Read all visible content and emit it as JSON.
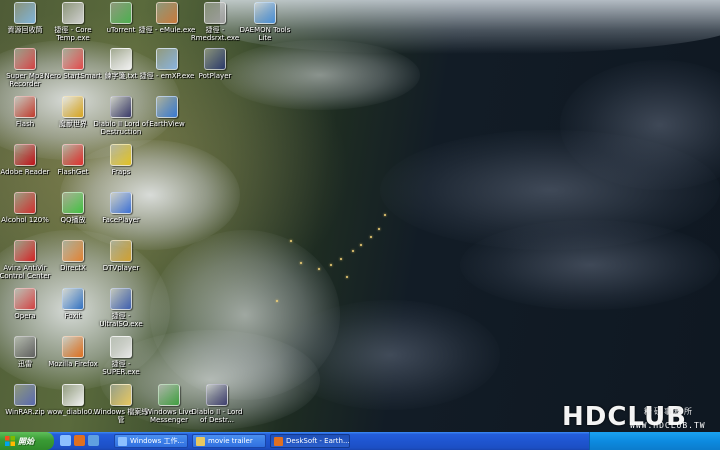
{
  "desktop": {
    "icons": [
      {
        "label": "資源回收筒",
        "icon": "recycle-bin-icon",
        "color": "#7fb3d9"
      },
      {
        "label": "捷徑 - Core Temp.exe",
        "icon": "shortcut-icon",
        "color": "#cfcfcf"
      },
      {
        "label": "uTorrent",
        "icon": "utorrent-icon",
        "color": "#4caf50"
      },
      {
        "label": "捷徑 - eMule.exe",
        "icon": "emule-icon",
        "color": "#c97a3c"
      },
      {
        "label": "捷徑 - Rmedsrxt.exe",
        "icon": "shortcut-icon",
        "color": "#a0a0a0"
      },
      {
        "label": "DAEMON Tools Lite",
        "icon": "daemon-tools-icon",
        "color": "#4a90d9"
      },
      {
        "label": "Super Mp3 Recorder",
        "icon": "mp3-recorder-icon",
        "color": "#d04040"
      },
      {
        "label": "Nero StartSmart",
        "icon": "nero-icon",
        "color": "#e04848"
      },
      {
        "label": "練字箋.txt",
        "icon": "text-file-icon",
        "color": "#f0f0f0"
      },
      {
        "label": "捷徑 - emXP.exe",
        "icon": "shortcut-icon",
        "color": "#8ab4e0"
      },
      {
        "label": "PotPlayer",
        "icon": "potplayer-icon",
        "color": "#2b3a6b"
      },
      {
        "label": "Flash",
        "icon": "flash-icon",
        "color": "#c0392b"
      },
      {
        "label": "魔獸世界",
        "icon": "wow-icon",
        "color": "#d8a520"
      },
      {
        "label": "Diablo II Lord of Destruction",
        "icon": "diablo-icon",
        "color": "#3a3a6a"
      },
      {
        "label": "EarthView",
        "icon": "earth-icon",
        "color": "#3a7bd5"
      },
      {
        "label": "Adobe Reader",
        "icon": "adobe-reader-icon",
        "color": "#c0121a"
      },
      {
        "label": "FlashGet",
        "icon": "flashget-icon",
        "color": "#e03030"
      },
      {
        "label": "Fraps",
        "icon": "fraps-icon",
        "color": "#e0c020"
      },
      {
        "label": "Alcohol 120%",
        "icon": "alcohol-icon",
        "color": "#d03030"
      },
      {
        "label": "QQ播放",
        "icon": "qq-icon",
        "color": "#40c040"
      },
      {
        "label": "FacePlayer",
        "icon": "faceplayer-icon",
        "color": "#3b6fd4"
      },
      {
        "label": "Avira AntiVir Control Center",
        "icon": "avira-icon",
        "color": "#d02020"
      },
      {
        "label": "DirectX",
        "icon": "directx-icon",
        "color": "#e08030"
      },
      {
        "label": "DTVplayer",
        "icon": "dtvplayer-icon",
        "color": "#d0a030"
      },
      {
        "label": "Opera",
        "icon": "opera-icon",
        "color": "#d04040"
      },
      {
        "label": "Foxit",
        "icon": "foxit-icon",
        "color": "#3070c0"
      },
      {
        "label": "捷徑 - UltraISO.exe",
        "icon": "ultraiso-icon",
        "color": "#4060b0"
      },
      {
        "label": "迅雷",
        "icon": "thunder-icon",
        "color": "#606060"
      },
      {
        "label": "Mozilla Firefox",
        "icon": "firefox-icon",
        "color": "#e07020"
      },
      {
        "label": "捷徑 - SUPER.exe",
        "icon": "super-icon",
        "color": "#e8e8e8"
      },
      {
        "label": "WinRAR.zip",
        "icon": "winrar-icon",
        "color": "#5a6ab0"
      },
      {
        "label": "wow_diablo0...",
        "icon": "document-icon",
        "color": "#f0f0f0"
      },
      {
        "label": "Windows 檔案總管",
        "icon": "explorer-icon",
        "color": "#e8c860"
      },
      {
        "label": "Windows Live Messenger",
        "icon": "messenger-icon",
        "color": "#40a040"
      },
      {
        "label": "Diablo II - Lord of Destr...",
        "icon": "diablo-icon",
        "color": "#404070"
      }
    ]
  },
  "watermark": {
    "brand": "HDCLUB",
    "cjk": "精研事務所",
    "site": "WWW.HDCLUB.TW"
  },
  "taskbar": {
    "start_label": "開始",
    "quick_launch": [
      {
        "icon": "show-desktop-icon",
        "color": "#8cc0ff"
      },
      {
        "icon": "firefox-icon",
        "color": "#e07020"
      },
      {
        "icon": "media-player-icon",
        "color": "#60a0e0"
      }
    ],
    "tasks": [
      {
        "label": "Windows 工作...",
        "icon": "window-icon",
        "color": "#8cc0ff",
        "active": false
      },
      {
        "label": "movie trailer",
        "icon": "folder-icon",
        "color": "#e8c860",
        "active": false
      },
      {
        "label": "DeskSoft - Earth...",
        "icon": "earth-icon",
        "color": "#e07020",
        "active": true
      }
    ],
    "colors": {
      "bar": "#245edb",
      "start": "#3a9b34",
      "tray": "#0d8be0"
    }
  }
}
